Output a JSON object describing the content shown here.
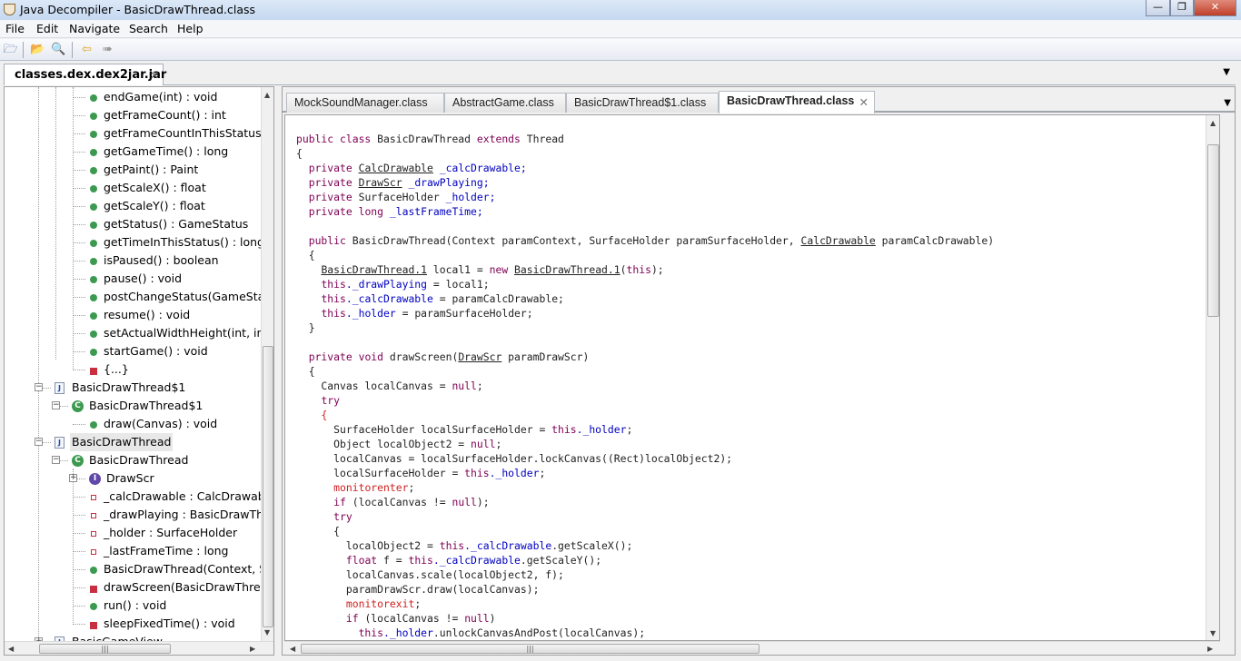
{
  "window": {
    "title": "Java Decompiler - BasicDrawThread.class",
    "controls": [
      "minimize",
      "restore",
      "close"
    ]
  },
  "menu": [
    "File",
    "Edit",
    "Navigate",
    "Search",
    "Help"
  ],
  "toolbar": {
    "icons": [
      "open-file-icon",
      "open-type-icon",
      "search-icon",
      "back-arrow-icon",
      "forward-arrow-icon"
    ]
  },
  "jar_tab": {
    "label": "classes.dex.dex2jar.jar"
  },
  "tree": [
    {
      "label": "endGame(int) : void",
      "level": 3,
      "icon": "m"
    },
    {
      "label": "getFrameCount() : int",
      "level": 3,
      "icon": "m"
    },
    {
      "label": "getFrameCountInThisStatus() : ",
      "level": 3,
      "icon": "m"
    },
    {
      "label": "getGameTime() : long",
      "level": 3,
      "icon": "m"
    },
    {
      "label": "getPaint() : Paint",
      "level": 3,
      "icon": "m"
    },
    {
      "label": "getScaleX() : float",
      "level": 3,
      "icon": "m"
    },
    {
      "label": "getScaleY() : float",
      "level": 3,
      "icon": "m"
    },
    {
      "label": "getStatus() : GameStatus",
      "level": 3,
      "icon": "m"
    },
    {
      "label": "getTimeInThisStatus() : long",
      "level": 3,
      "icon": "m"
    },
    {
      "label": "isPaused() : boolean",
      "level": 3,
      "icon": "m"
    },
    {
      "label": "pause() : void",
      "level": 3,
      "icon": "m"
    },
    {
      "label": "postChangeStatus(GameStatus",
      "level": 3,
      "icon": "m"
    },
    {
      "label": "resume() : void",
      "level": 3,
      "icon": "m"
    },
    {
      "label": "setActualWidthHeight(int, int) :",
      "level": 3,
      "icon": "m"
    },
    {
      "label": "startGame() : void",
      "level": 3,
      "icon": "m"
    },
    {
      "label": "{...}",
      "level": 3,
      "icon": "pm"
    },
    {
      "label": "BasicDrawThread$1",
      "level": 1,
      "icon": "file",
      "expander": "-"
    },
    {
      "label": "BasicDrawThread$1",
      "level": 2,
      "icon": "cls",
      "expander": "-"
    },
    {
      "label": "draw(Canvas) : void",
      "level": 3,
      "icon": "m"
    },
    {
      "label": "BasicDrawThread",
      "level": 1,
      "icon": "file",
      "expander": "-",
      "selected": true
    },
    {
      "label": "BasicDrawThread",
      "level": 2,
      "icon": "cls",
      "expander": "-"
    },
    {
      "label": "DrawScr",
      "level": 3,
      "icon": "int",
      "expander": "+"
    },
    {
      "label": "_calcDrawable : CalcDrawable",
      "level": 3,
      "icon": "priv"
    },
    {
      "label": "_drawPlaying : BasicDrawThread",
      "level": 3,
      "icon": "priv"
    },
    {
      "label": "_holder : SurfaceHolder",
      "level": 3,
      "icon": "priv"
    },
    {
      "label": "_lastFrameTime : long",
      "level": 3,
      "icon": "priv"
    },
    {
      "label": "BasicDrawThread(Context, SurfaceHolder",
      "level": 3,
      "icon": "m"
    },
    {
      "label": "drawScreen(BasicDrawThread",
      "level": 3,
      "icon": "pm"
    },
    {
      "label": "run() : void",
      "level": 3,
      "icon": "m"
    },
    {
      "label": "sleepFixedTime() : void",
      "level": 3,
      "icon": "pm"
    },
    {
      "label": "BasicGameView",
      "level": 1,
      "icon": "file",
      "expander": "+"
    }
  ],
  "editor_tabs": [
    {
      "label": "MockSoundManager.class"
    },
    {
      "label": "AbstractGame.class"
    },
    {
      "label": "BasicDrawThread$1.class"
    },
    {
      "label": "BasicDrawThread.class",
      "active": true
    }
  ],
  "code": [
    [
      [
        "public class ",
        "k"
      ],
      [
        "BasicDrawThread "
      ],
      [
        "extends ",
        "k"
      ],
      [
        "Thread"
      ]
    ],
    [
      [
        "{"
      ]
    ],
    [
      [
        "  "
      ],
      [
        "private ",
        "k"
      ],
      [
        "CalcDrawable",
        "u"
      ],
      [
        " _calcDrawable;",
        "f"
      ]
    ],
    [
      [
        "  "
      ],
      [
        "private ",
        "k"
      ],
      [
        "DrawScr",
        "u"
      ],
      [
        " _drawPlaying;",
        "f"
      ]
    ],
    [
      [
        "  "
      ],
      [
        "private ",
        "k"
      ],
      [
        "SurfaceHolder"
      ],
      [
        " _holder;",
        "f"
      ]
    ],
    [
      [
        "  "
      ],
      [
        "private long ",
        "k"
      ],
      [
        "_lastFrameTime;",
        "f"
      ]
    ],
    [
      [
        ""
      ]
    ],
    [
      [
        "  "
      ],
      [
        "public ",
        "k"
      ],
      [
        "BasicDrawThread(Context paramContext, SurfaceHolder paramSurfaceHolder, "
      ],
      [
        "CalcDrawable",
        "u"
      ],
      [
        " paramCalcDrawable)"
      ]
    ],
    [
      [
        "  {"
      ]
    ],
    [
      [
        "    "
      ],
      [
        "BasicDrawThread.1",
        "u"
      ],
      [
        " local1 = "
      ],
      [
        "new ",
        "k"
      ],
      [
        "BasicDrawThread.1",
        "u"
      ],
      [
        "("
      ],
      [
        "this",
        "k"
      ],
      [
        ");"
      ]
    ],
    [
      [
        "    "
      ],
      [
        "this",
        "k"
      ],
      [
        "._drawPlaying",
        "f"
      ],
      [
        " = local1;"
      ]
    ],
    [
      [
        "    "
      ],
      [
        "this",
        "k"
      ],
      [
        "._calcDrawable",
        "f"
      ],
      [
        " = paramCalcDrawable;"
      ]
    ],
    [
      [
        "    "
      ],
      [
        "this",
        "k"
      ],
      [
        "._holder",
        "f"
      ],
      [
        " = paramSurfaceHolder;"
      ]
    ],
    [
      [
        "  }"
      ]
    ],
    [
      [
        ""
      ]
    ],
    [
      [
        "  "
      ],
      [
        "private void ",
        "k"
      ],
      [
        "drawScreen("
      ],
      [
        "DrawScr",
        "u"
      ],
      [
        " paramDrawScr)"
      ]
    ],
    [
      [
        "  {"
      ]
    ],
    [
      [
        "    Canvas localCanvas = "
      ],
      [
        "null",
        "k"
      ],
      [
        ";"
      ]
    ],
    [
      [
        "    "
      ],
      [
        "try",
        "k"
      ]
    ],
    [
      [
        "    "
      ],
      [
        "{",
        "r"
      ]
    ],
    [
      [
        "      SurfaceHolder localSurfaceHolder = "
      ],
      [
        "this",
        "k"
      ],
      [
        "._holder",
        "f"
      ],
      [
        ";"
      ]
    ],
    [
      [
        "      Object localObject2 = "
      ],
      [
        "null",
        "k"
      ],
      [
        ";"
      ]
    ],
    [
      [
        "      localCanvas = localSurfaceHolder.lockCanvas((Rect)localObject2);"
      ]
    ],
    [
      [
        "      localSurfaceHolder = "
      ],
      [
        "this",
        "k"
      ],
      [
        "._holder",
        "f"
      ],
      [
        ";"
      ]
    ],
    [
      [
        "      "
      ],
      [
        "monitorenter",
        "r"
      ],
      [
        ";"
      ]
    ],
    [
      [
        "      "
      ],
      [
        "if ",
        "k"
      ],
      [
        "(localCanvas != "
      ],
      [
        "null",
        "k"
      ],
      [
        ");"
      ]
    ],
    [
      [
        "      "
      ],
      [
        "try",
        "k"
      ]
    ],
    [
      [
        "      {"
      ]
    ],
    [
      [
        "        localObject2 = "
      ],
      [
        "this",
        "k"
      ],
      [
        "._calcDrawable",
        "f"
      ],
      [
        ".getScaleX();"
      ]
    ],
    [
      [
        "        "
      ],
      [
        "float ",
        "k"
      ],
      [
        "f = "
      ],
      [
        "this",
        "k"
      ],
      [
        "._calcDrawable",
        "f"
      ],
      [
        ".getScaleY();"
      ]
    ],
    [
      [
        "        localCanvas.scale(localObject2, f);"
      ]
    ],
    [
      [
        "        paramDrawScr.draw(localCanvas);"
      ]
    ],
    [
      [
        "        "
      ],
      [
        "monitorexit",
        "r"
      ],
      [
        ";"
      ]
    ],
    [
      [
        "        "
      ],
      [
        "if ",
        "k"
      ],
      [
        "(localCanvas != "
      ],
      [
        "null",
        "k"
      ],
      [
        ")"
      ]
    ],
    [
      [
        "          "
      ],
      [
        "this",
        "k"
      ],
      [
        "._holder",
        "f"
      ],
      [
        ".unlockCanvasAndPost(localCanvas);"
      ]
    ]
  ],
  "colors": {
    "keyword": "#7f0055",
    "field": "#0000c0",
    "special": "#d02020",
    "titlebar": "#c6d9f1"
  }
}
